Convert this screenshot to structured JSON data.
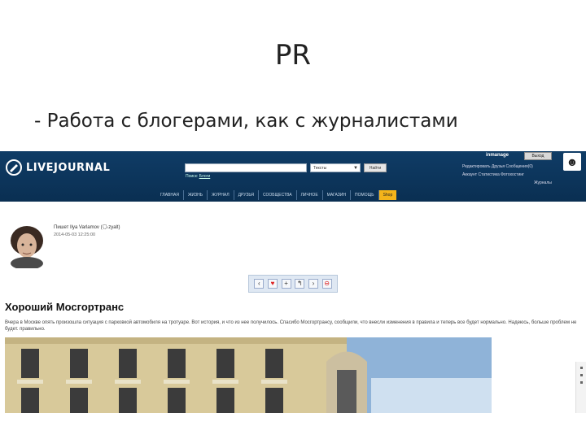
{
  "slide": {
    "title": "PR",
    "bullet": "- Работа с блогерами, как с журналистами"
  },
  "lj": {
    "logo_text": "LIVEJOURNAL",
    "search": {
      "value": "",
      "select_value": "Тексты",
      "button_label": "Найти",
      "by_prefix": "Поиск:",
      "by_value": "Блоги"
    },
    "user": "inmanage",
    "logout_label": "Выход",
    "links": [
      "Редактировать Друзья Сообщения(0)",
      "Аккаунт  Статистика  Фотохостинг",
      "Журналы"
    ],
    "nav": [
      "ГЛАВНАЯ",
      "ЖИЗНЬ",
      "ЖУРНАЛ",
      "ДРУЗЬЯ",
      "СООБЩЕСТВА",
      "ЛИЧНОЕ",
      "МАГАЗИН",
      "ПОМОЩЬ",
      "Shop"
    ]
  },
  "entry": {
    "poster": "Пишет Ilya Varlamov (🗣zyalt)",
    "date": "2014-05-03 12:25:00",
    "tool_icons": [
      "back-icon",
      "heart-icon",
      "add-icon",
      "share-icon",
      "forward-icon",
      "block-icon"
    ],
    "title": "Хороший Мосгортранс",
    "text": "Вчера в Москве опять произошла ситуация с парковкой автомобиля на тротуаре. Вот история, и что из нее получилось. Спасибо Мосгортрансу, сообщили, что внесли изменения в правила и теперь все будет нормально. Надеюсь, больше проблем не будет. правильно."
  },
  "colors": {
    "header_bg": "#0f3c66",
    "shop_bg": "#f4b41a",
    "tools_bg": "#dfe8f3"
  }
}
